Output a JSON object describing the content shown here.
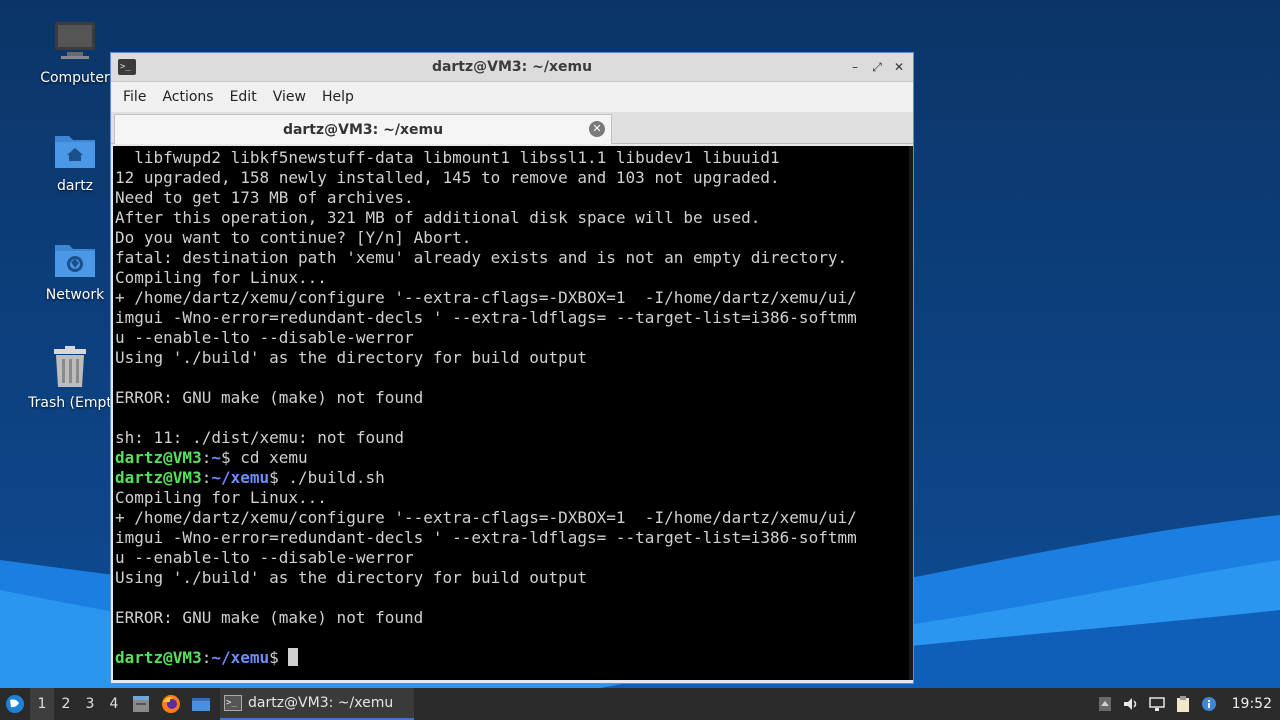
{
  "desktop": {
    "icons": [
      {
        "label": "Computer",
        "icon": "computer-icon"
      },
      {
        "label": "dartz",
        "icon": "home-folder-icon"
      },
      {
        "label": "Network",
        "icon": "network-folder-icon"
      },
      {
        "label": "Trash (Empt",
        "icon": "trash-icon"
      }
    ]
  },
  "window": {
    "title": "dartz@VM3: ~/xemu",
    "controls": {
      "minimize": "–",
      "maximize": "⤢",
      "close": "✕"
    },
    "menu": [
      "File",
      "Actions",
      "Edit",
      "View",
      "Help"
    ],
    "tab": {
      "title": "dartz@VM3: ~/xemu",
      "close": "✕"
    }
  },
  "terminal": {
    "lines": [
      "  libfwupd2 libkf5newstuff-data libmount1 libssl1.1 libudev1 libuuid1",
      "12 upgraded, 158 newly installed, 145 to remove and 103 not upgraded.",
      "Need to get 173 MB of archives.",
      "After this operation, 321 MB of additional disk space will be used.",
      "Do you want to continue? [Y/n] Abort.",
      "fatal: destination path 'xemu' already exists and is not an empty directory.",
      "Compiling for Linux...",
      "+ /home/dartz/xemu/configure '--extra-cflags=-DXBOX=1  -I/home/dartz/xemu/ui/",
      "imgui -Wno-error=redundant-decls ' --extra-ldflags= --target-list=i386-softmm",
      "u --enable-lto --disable-werror",
      "Using './build' as the directory for build output",
      "",
      "ERROR: GNU make (make) not found",
      "",
      "sh: 11: ./dist/xemu: not found"
    ],
    "prompt1": {
      "user": "dartz@VM3",
      "path": "~",
      "cmd": " cd xemu"
    },
    "prompt2": {
      "user": "dartz@VM3",
      "path": "~/xemu",
      "cmd": " ./build.sh"
    },
    "lines2": [
      "Compiling for Linux...",
      "+ /home/dartz/xemu/configure '--extra-cflags=-DXBOX=1  -I/home/dartz/xemu/ui/",
      "imgui -Wno-error=redundant-decls ' --extra-ldflags= --target-list=i386-softmm",
      "u --enable-lto --disable-werror",
      "Using './build' as the directory for build output",
      "",
      "ERROR: GNU make (make) not found",
      ""
    ],
    "prompt3": {
      "user": "dartz@VM3",
      "path": "~/xemu",
      "cmd": " "
    },
    "separator": ":",
    "dollar": "$"
  },
  "taskbar": {
    "workspaces": [
      "1",
      "2",
      "3",
      "4"
    ],
    "active_workspace": "1",
    "task_title": "dartz@VM3: ~/xemu",
    "clock": "19:52"
  },
  "colors": {
    "prompt_user": "#55e05a",
    "prompt_path": "#6f8cff",
    "window_border": "#5c8fd6"
  }
}
